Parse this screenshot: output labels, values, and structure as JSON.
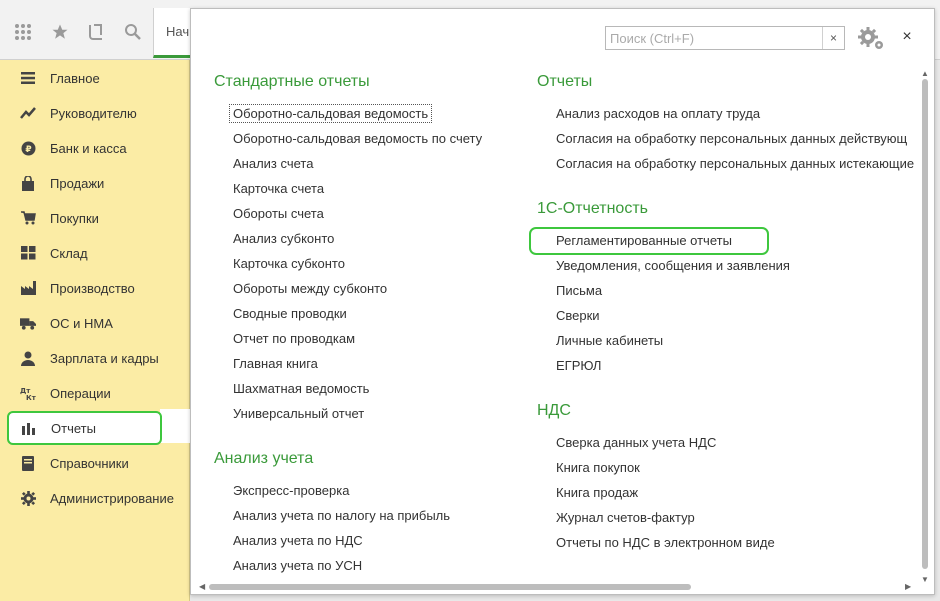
{
  "toolbar": {
    "apps_icon": "grid-icon",
    "favorites_icon": "star-icon",
    "history_icon": "history-icon",
    "search_icon": "search-icon",
    "start_tab_label": "Нач"
  },
  "sidebar": {
    "items": [
      {
        "label": "Главное",
        "icon": "menu-lines-icon"
      },
      {
        "label": "Руководителю",
        "icon": "trend-icon"
      },
      {
        "label": "Банк и касса",
        "icon": "ruble-icon"
      },
      {
        "label": "Продажи",
        "icon": "bag-icon"
      },
      {
        "label": "Покупки",
        "icon": "cart-icon"
      },
      {
        "label": "Склад",
        "icon": "warehouse-icon"
      },
      {
        "label": "Производство",
        "icon": "factory-icon"
      },
      {
        "label": "ОС и НМА",
        "icon": "truck-icon"
      },
      {
        "label": "Зарплата и кадры",
        "icon": "person-icon"
      },
      {
        "label": "Операции",
        "icon": "debit-credit-icon"
      },
      {
        "label": "Отчеты",
        "icon": "bar-chart-icon",
        "active": true
      },
      {
        "label": "Справочники",
        "icon": "book-icon"
      },
      {
        "label": "Администрирование",
        "icon": "gear-icon"
      }
    ]
  },
  "panel": {
    "search_placeholder": "Поиск (Ctrl+F)",
    "clear_label": "×",
    "close_label": "×",
    "left_sections": [
      {
        "title": "Стандартные отчеты",
        "links": [
          "Оборотно-сальдовая ведомость",
          "Оборотно-сальдовая ведомость по счету",
          "Анализ счета",
          "Карточка счета",
          "Обороты счета",
          "Анализ субконто",
          "Карточка субконто",
          "Обороты между субконто",
          "Сводные проводки",
          "Отчет по проводкам",
          "Главная книга",
          "Шахматная ведомость",
          "Универсальный отчет"
        ]
      },
      {
        "title": "Анализ учета",
        "links": [
          "Экспресс-проверка",
          "Анализ учета по налогу на прибыль",
          "Анализ учета по НДС",
          "Анализ учета по УСН"
        ]
      }
    ],
    "right_sections": [
      {
        "title": "Отчеты",
        "links": [
          "Анализ расходов на оплату труда",
          "Согласия на обработку персональных данных действующ",
          "Согласия на обработку персональных данных истекающие"
        ]
      },
      {
        "title": "1С-Отчетность",
        "links": [
          "Регламентированные отчеты",
          "Уведомления, сообщения и заявления",
          "Письма",
          "Сверки",
          "Личные кабинеты",
          "ЕГРЮЛ"
        ]
      },
      {
        "title": "НДС",
        "links": [
          "Сверка данных учета НДС",
          "Книга покупок",
          "Книга продаж",
          "Журнал счетов-фактур",
          "Отчеты по НДС в электронном виде"
        ]
      }
    ]
  },
  "colors": {
    "sidebar_bg": "#fbeca5",
    "section_title": "#3a9a3a",
    "highlight": "#3ec73e",
    "active_tab_underline": "#3a9a3a"
  }
}
